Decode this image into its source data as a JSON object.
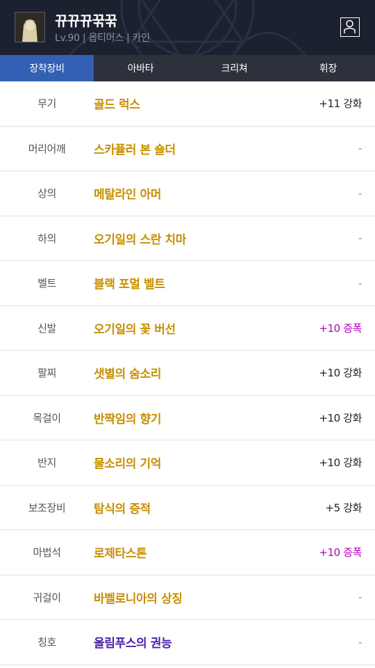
{
  "character": {
    "name": "뀨뀨뀨꾺꾺",
    "subtitle": "Lv.90 | 옵티머스 | 카인"
  },
  "icons": {
    "profile": "person-icon",
    "avatar": "character-portrait"
  },
  "tabs": [
    {
      "label": "장착장비",
      "active": true
    },
    {
      "label": "아바타",
      "active": false
    },
    {
      "label": "크리쳐",
      "active": false
    },
    {
      "label": "휘장",
      "active": false
    }
  ],
  "equipment": [
    {
      "slot": "무기",
      "item": "골드 럭스",
      "upgrade": "+11 강화"
    },
    {
      "slot": "머리어깨",
      "item": "스카퓰러 본 숄더",
      "upgrade": "-"
    },
    {
      "slot": "상의",
      "item": "메탈라인 아머",
      "upgrade": "-"
    },
    {
      "slot": "하의",
      "item": "오기일의 스란 치마",
      "upgrade": "-"
    },
    {
      "slot": "벨트",
      "item": "블랙 포멀 벨트",
      "upgrade": "-"
    },
    {
      "slot": "신발",
      "item": "오기일의 꽃 버선",
      "upgrade": "+10 증폭"
    },
    {
      "slot": "팔찌",
      "item": "샛별의 숨소리",
      "upgrade": "+10 강화"
    },
    {
      "slot": "목걸이",
      "item": "반짝임의 향기",
      "upgrade": "+10 강화"
    },
    {
      "slot": "반지",
      "item": "물소리의 기억",
      "upgrade": "+10 강화"
    },
    {
      "slot": "보조장비",
      "item": "탐식의 증적",
      "upgrade": "+5 강화"
    },
    {
      "slot": "마법석",
      "item": "로제타스톤",
      "upgrade": "+10 증폭"
    },
    {
      "slot": "귀걸이",
      "item": "바벨로니아의 상징",
      "upgrade": "-"
    },
    {
      "slot": "칭호",
      "item": "올림푸스의 권능",
      "upgrade": "-"
    }
  ],
  "colors": {
    "header_bg": "#1c2130",
    "tab_bar_bg": "#2c313c",
    "active_tab_bg": "#3360b4",
    "item_gold": "#c78f00",
    "item_purple": "#4b20a8",
    "amplify_magenta": "#b000b8"
  }
}
